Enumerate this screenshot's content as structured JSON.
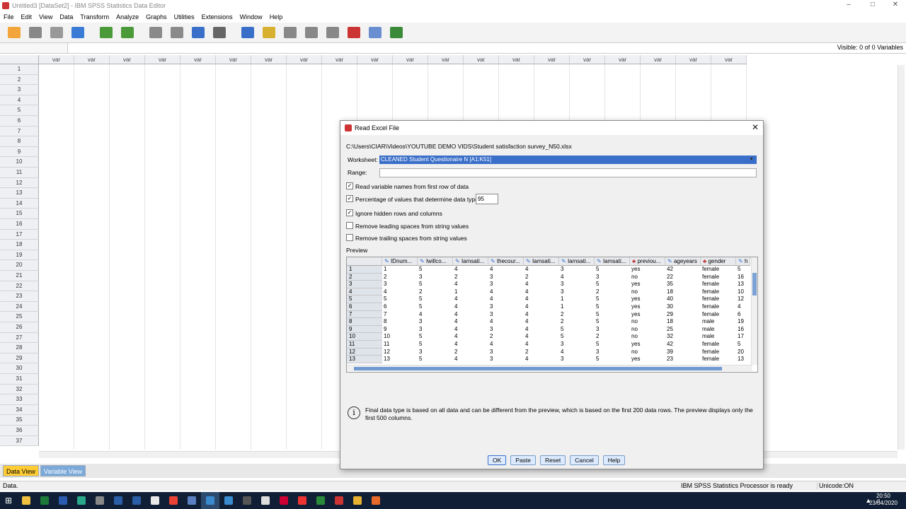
{
  "window": {
    "title": "Untitled3 [DataSet2] - IBM SPSS Statistics Data Editor"
  },
  "menu": [
    "File",
    "Edit",
    "View",
    "Data",
    "Transform",
    "Analyze",
    "Graphs",
    "Utilities",
    "Extensions",
    "Window",
    "Help"
  ],
  "toolbar": {
    "icons": [
      "open-icon",
      "save-icon",
      "print-icon",
      "dialog-recall-icon",
      "undo-icon",
      "redo-icon",
      "goto-case-icon",
      "goto-variable-icon",
      "variables-icon",
      "find-icon",
      "insert-cases-icon",
      "insert-variable-icon",
      "split-file-icon",
      "weight-cases-icon",
      "select-cases-icon",
      "value-labels-icon",
      "use-sets-icon",
      "show-all-icon"
    ]
  },
  "cellbar": {
    "visible": "Visible: 0 of 0 Variables"
  },
  "grid": {
    "column_header": "var",
    "column_count": 20,
    "rows": [
      "1",
      "2",
      "3",
      "4",
      "5",
      "6",
      "7",
      "8",
      "9",
      "10",
      "11",
      "12",
      "13",
      "14",
      "15",
      "16",
      "17",
      "18",
      "19",
      "20",
      "21",
      "22",
      "23",
      "24",
      "25",
      "26",
      "27",
      "28",
      "29",
      "30",
      "31",
      "32",
      "33",
      "34",
      "35",
      "36",
      "37"
    ]
  },
  "tabs": {
    "data_view": "Data View",
    "variable_view": "Variable View"
  },
  "status": {
    "left": "Data.",
    "processor": "IBM SPSS Statistics Processor is ready",
    "unicode": "Unicode:ON"
  },
  "clock": {
    "time": "20:50",
    "date": "23/04/2020"
  },
  "dialog": {
    "title": "Read Excel File",
    "path": "C:\\Users\\CIAR\\Videos\\YOUTUBE DEMO VIDS\\Student satisfaction survey_N50.xlsx",
    "worksheet_label": "Worksheet:",
    "worksheet_value": "CLEANED Student Questionaire N [A1:K51]",
    "range_label": "Range:",
    "opt_read_names": "Read variable names from first row of data",
    "opt_percentage": "Percentage of values that determine data type:",
    "percentage_value": "95",
    "opt_ignore_hidden": "Ignore hidden rows and columns",
    "opt_leading": "Remove leading spaces from string values",
    "opt_trailing": "Remove trailing spaces from string values",
    "preview_label": "Preview",
    "preview": {
      "columns": [
        "IDnum...",
        "Iwillco...",
        "Iamsati...",
        "thecour...",
        "Iamsati...",
        "Iamsati...",
        "Iamsati...",
        "previou...",
        "ageyears",
        "gender",
        "h"
      ],
      "column_types": [
        "scale",
        "scale",
        "scale",
        "scale",
        "scale",
        "scale",
        "scale",
        "nominal",
        "scale",
        "nominal",
        "scale"
      ],
      "rows": [
        [
          "1",
          "5",
          "4",
          "4",
          "4",
          "3",
          "5",
          "yes",
          "42",
          "female",
          "5"
        ],
        [
          "2",
          "3",
          "2",
          "3",
          "2",
          "4",
          "3",
          "no",
          "22",
          "female",
          "16"
        ],
        [
          "3",
          "5",
          "4",
          "3",
          "4",
          "3",
          "5",
          "yes",
          "35",
          "female",
          "13"
        ],
        [
          "4",
          "2",
          "1",
          "4",
          "4",
          "3",
          "2",
          "no",
          "18",
          "female",
          "10"
        ],
        [
          "5",
          "5",
          "4",
          "4",
          "4",
          "1",
          "5",
          "yes",
          "40",
          "female",
          "12"
        ],
        [
          "6",
          "5",
          "4",
          "3",
          "4",
          "1",
          "5",
          "yes",
          "30",
          "female",
          "4"
        ],
        [
          "7",
          "4",
          "4",
          "3",
          "4",
          "2",
          "5",
          "yes",
          "29",
          "female",
          "6"
        ],
        [
          "8",
          "3",
          "4",
          "4",
          "4",
          "2",
          "5",
          "no",
          "18",
          "male",
          "19"
        ],
        [
          "9",
          "3",
          "4",
          "3",
          "4",
          "5",
          "3",
          "no",
          "25",
          "male",
          "16"
        ],
        [
          "10",
          "5",
          "4",
          "2",
          "4",
          "5",
          "2",
          "no",
          "32",
          "male",
          "17"
        ],
        [
          "11",
          "5",
          "4",
          "4",
          "4",
          "3",
          "5",
          "yes",
          "42",
          "female",
          "5"
        ],
        [
          "12",
          "3",
          "2",
          "3",
          "2",
          "4",
          "3",
          "no",
          "39",
          "female",
          "20"
        ],
        [
          "13",
          "5",
          "4",
          "3",
          "4",
          "3",
          "5",
          "yes",
          "23",
          "female",
          "13"
        ]
      ]
    },
    "info_text": "Final data type is based on all data and can be different from the preview, which is based on the first 200 data rows. The preview displays only the first 500 columns.",
    "buttons": {
      "ok": "OK",
      "paste": "Paste",
      "reset": "Reset",
      "cancel": "Cancel",
      "help": "Help"
    }
  },
  "colors": {
    "accent": "#3a6fc9",
    "tab_active": "#ffcc33",
    "tab_inactive": "#7ba9d9",
    "taskbar": "#101f35"
  }
}
